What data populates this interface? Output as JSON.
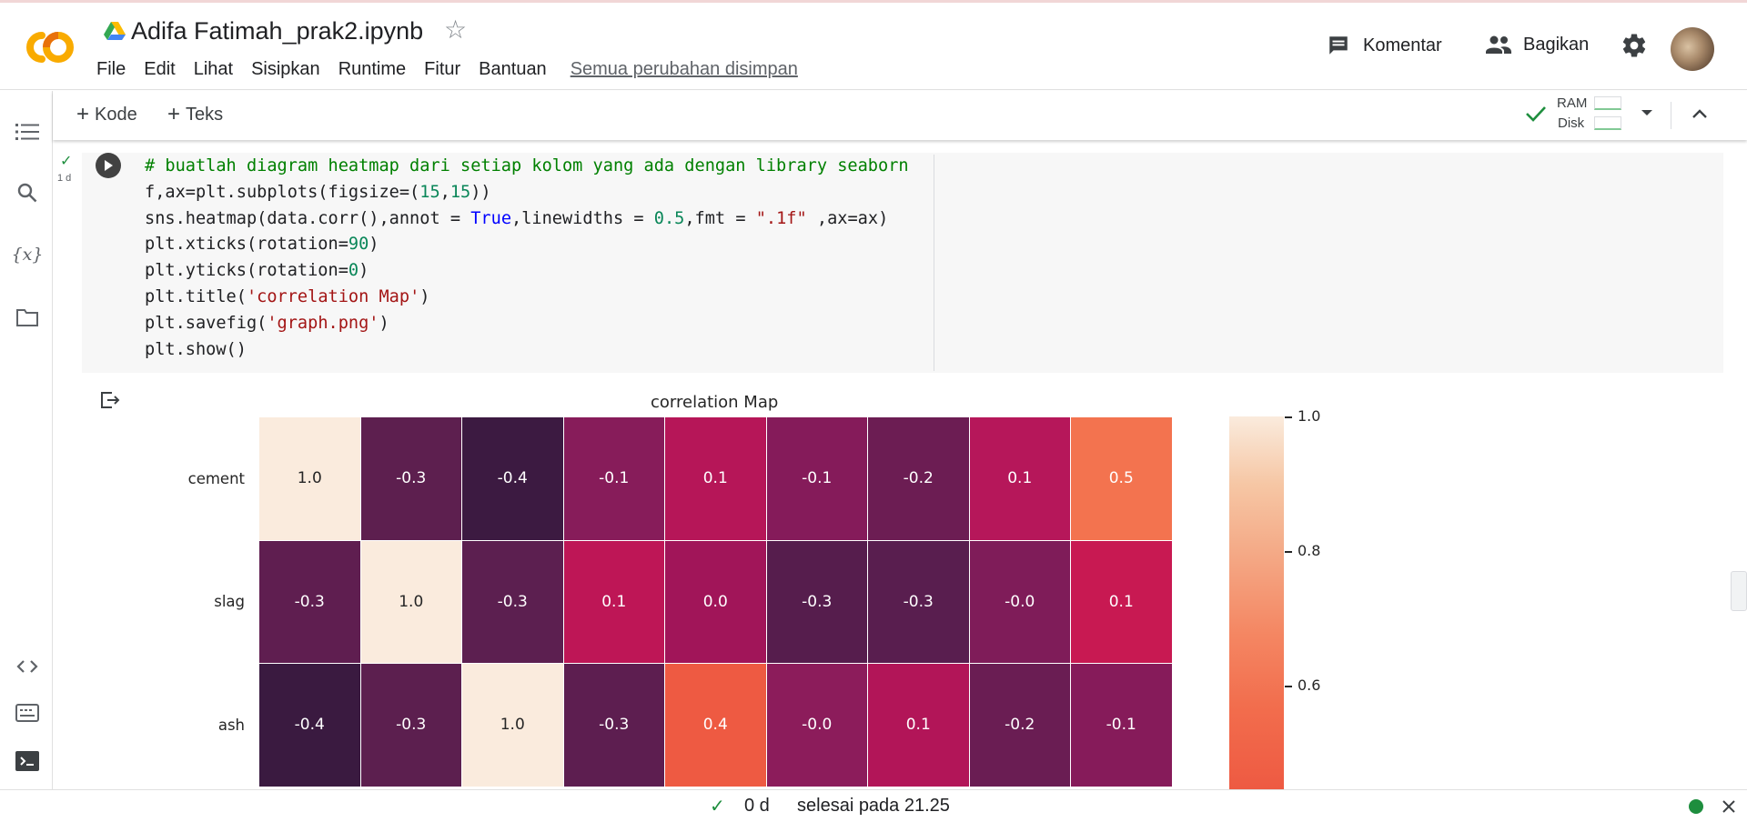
{
  "header": {
    "notebook_title": "Adifa Fatimah_prak2.ipynb",
    "menu": [
      "File",
      "Edit",
      "Lihat",
      "Sisipkan",
      "Runtime",
      "Fitur",
      "Bantuan"
    ],
    "saved_status": "Semua perubahan disimpan",
    "comment_label": "Komentar",
    "share_label": "Bagikan"
  },
  "toolbar": {
    "add_code_label": "Kode",
    "add_text_label": "Teks",
    "ram_label": "RAM",
    "disk_label": "Disk"
  },
  "cell": {
    "exec_time": "1 d",
    "code_lines": [
      "# buatlah diagram heatmap dari setiap kolom yang ada dengan library seaborn",
      "f,ax=plt.subplots(figsize=(15,15))",
      "sns.heatmap(data.corr(),annot = True,linewidths = 0.5,fmt = \".1f\" ,ax=ax)",
      "plt.xticks(rotation=90)",
      "plt.yticks(rotation=0)",
      "plt.title('correlation Map')",
      "plt.savefig('graph.png')",
      "plt.show()"
    ]
  },
  "chart_data": {
    "type": "heatmap",
    "title": "correlation Map",
    "rows": [
      "cement",
      "slag",
      "ash"
    ],
    "values": [
      [
        "1.0",
        "-0.3",
        "-0.4",
        "-0.1",
        "0.1",
        "-0.1",
        "-0.2",
        "0.1",
        "0.5"
      ],
      [
        "-0.3",
        "1.0",
        "-0.3",
        "0.1",
        "0.0",
        "-0.3",
        "-0.3",
        "-0.0",
        "0.1"
      ],
      [
        "-0.4",
        "-0.3",
        "1.0",
        "-0.3",
        "0.4",
        "-0.0",
        "0.1",
        "-0.2",
        "-0.1"
      ]
    ],
    "colors": [
      [
        "#faebdd",
        "#5d1f4f",
        "#3c1a41",
        "#871c5a",
        "#b61658",
        "#851b5a",
        "#6c1d53",
        "#b6175a",
        "#f3734f"
      ],
      [
        "#5f1e50",
        "#faebdd",
        "#5c1f50",
        "#be1656",
        "#a11559",
        "#561d4d",
        "#591e4f",
        "#7f1c59",
        "#c81952"
      ],
      [
        "#3a1a40",
        "#5c1f4f",
        "#faebdd",
        "#5d1e50",
        "#ee5a42",
        "#8c1c5b",
        "#b21558",
        "#6a1d53",
        "#861b5a"
      ]
    ],
    "colorbar_ticks": [
      "1.0",
      "0.8",
      "0.6"
    ],
    "colormap": "rocket"
  },
  "statusbar": {
    "elapsed": "0 d",
    "finished_text": "selesai pada 21.25"
  },
  "colors": {
    "accent_orange": "#f9ab00",
    "status_green": "#1e8e3e"
  }
}
